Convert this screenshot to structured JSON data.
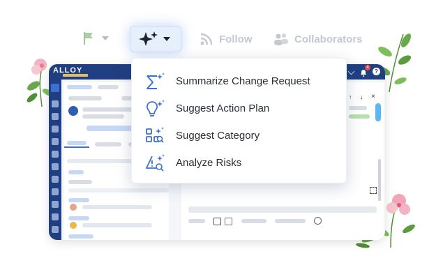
{
  "toolbar": {
    "ai_button_icon": "sparkles-icon",
    "follow_label": "Follow",
    "collaborators_label": "Collaborators"
  },
  "ai_menu": {
    "items": [
      {
        "label": "Summarize Change Request",
        "icon": "sigma-sparkle-icon"
      },
      {
        "label": "Suggest Action Plan",
        "icon": "lightbulb-sparkle-icon"
      },
      {
        "label": "Suggest Category",
        "icon": "category-search-icon"
      },
      {
        "label": "Analyze Risks",
        "icon": "warning-search-icon"
      }
    ]
  },
  "app": {
    "logo_text": "ALLOY",
    "notification_count": "4"
  },
  "colors": {
    "accent": "#3d6fd1",
    "nav": "#1f3f80",
    "ai_button_bg": "#e6effc",
    "muted": "#c4c8cf"
  }
}
